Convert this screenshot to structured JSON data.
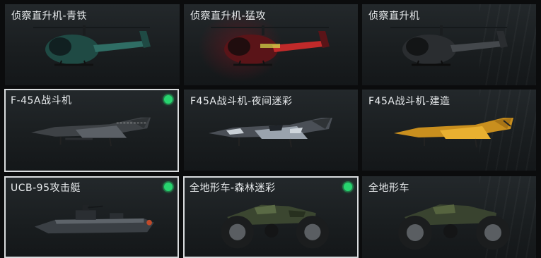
{
  "vehicles": [
    {
      "title": "侦察直升机-青铁",
      "equipped": false,
      "kind": "helicopter",
      "colors": {
        "body": "#1f4a44",
        "accent": "#2f6d64"
      }
    },
    {
      "title": "侦察直升机-猛攻",
      "equipped": false,
      "kind": "helicopter",
      "colors": {
        "body": "#5a1418",
        "accent": "#c02a2a"
      }
    },
    {
      "title": "侦察直升机",
      "equipped": false,
      "kind": "helicopter",
      "colors": {
        "body": "#2a2d30",
        "accent": "#44484c"
      }
    },
    {
      "title": "F-45A战斗机",
      "equipped": true,
      "kind": "jet",
      "colors": {
        "body": "#3e4246",
        "accent": "#5b6066"
      }
    },
    {
      "title": "F45A战斗机-夜间迷彩",
      "equipped": false,
      "kind": "jet",
      "colors": {
        "body": "#4a4f56",
        "accent": "#9aa3ad"
      }
    },
    {
      "title": "F45A战斗机-建造",
      "equipped": false,
      "kind": "jet",
      "colors": {
        "body": "#c98f1e",
        "accent": "#e9b030"
      }
    },
    {
      "title": "UCB-95攻击艇",
      "equipped": true,
      "kind": "boat",
      "colors": {
        "body": "#3a3f44",
        "accent": "#5e646a"
      }
    },
    {
      "title": "全地形车-森林迷彩",
      "equipped": true,
      "kind": "atv",
      "colors": {
        "body": "#3b4630",
        "accent": "#5a6a45"
      }
    },
    {
      "title": "全地形车",
      "equipped": false,
      "kind": "atv",
      "colors": {
        "body": "#39432f",
        "accent": "#56643f"
      }
    }
  ],
  "equipped_indicator_color": "#27d46e"
}
